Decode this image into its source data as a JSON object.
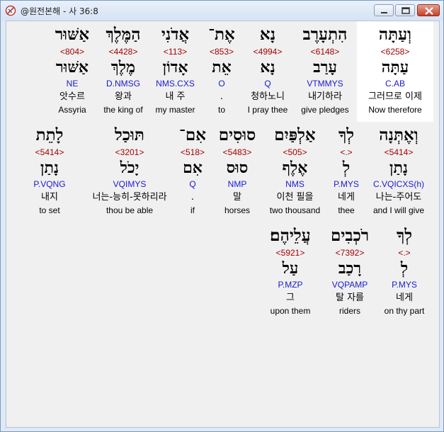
{
  "window": {
    "title": "@원전본해 - 사 36:8"
  },
  "rows": [
    {
      "words": [
        {
          "heb": "וְעַתָּה",
          "strong": "<6258>",
          "lemma": "עַתָּה",
          "parse": "C.AB",
          "korean": "그러므로 이제",
          "english": "Now therefore"
        },
        {
          "heb": "הִתְעָרֶב",
          "strong": "<6148>",
          "lemma": "עָרַב",
          "parse": "VTMMYS",
          "korean": "내기하라",
          "english": "give pledges"
        },
        {
          "heb": "נָא",
          "strong": "<4994>",
          "lemma": "נָא",
          "parse": "Q",
          "korean": "청하노니",
          "english": "I pray thee"
        },
        {
          "heb": "אֶת־",
          "strong": "<853>",
          "lemma": "אֵת",
          "parse": "O",
          "korean": ".",
          "english": "to"
        },
        {
          "heb": "אֲדֹנִי",
          "strong": "<113>",
          "lemma": "אָדוֹן",
          "parse": "NMS.CXS",
          "korean": "내 주",
          "english": "my master"
        },
        {
          "heb": "הַמֶּלֶךְ",
          "strong": "<4428>",
          "lemma": "מֶלֶךְ",
          "parse": "D.NMSG",
          "korean": "왕과",
          "english": "the king of"
        },
        {
          "heb": "אַשּׁוּר",
          "strong": "<804>",
          "lemma": "אַשּׁוּר",
          "parse": "NE",
          "korean": "앗수르",
          "english": "Assyria"
        }
      ]
    },
    {
      "words": [
        {
          "heb": "וְאֶתְּנָה",
          "strong": "<5414>",
          "lemma": "נָתַן",
          "parse": "C.VQICXS(h)",
          "korean": "나는-주어도",
          "english": "and I will give"
        },
        {
          "heb": "לְךָ",
          "strong": "<.>",
          "lemma": "לְ",
          "parse": "P.MYS",
          "korean": "네게",
          "english": "thee"
        },
        {
          "heb": "אַלְפַּיִם",
          "strong": "<505>",
          "lemma": "אֶלֶף",
          "parse": "NMS",
          "korean": "이천 필을",
          "english": "two thousand"
        },
        {
          "heb": "סוּסִים",
          "strong": "<5483>",
          "lemma": "סוּס",
          "parse": "NMP",
          "korean": "말",
          "english": "horses"
        },
        {
          "heb": "אִם־",
          "strong": "<518>",
          "lemma": "אִם",
          "parse": "Q",
          "korean": ".",
          "english": "if"
        },
        {
          "heb": "תּוּכַל",
          "strong": "<3201>",
          "lemma": "יָכֹל",
          "parse": "VQIMYS",
          "korean": "너는-능히-못하리라",
          "english": "thou be able"
        },
        {
          "heb": "לָתֵת",
          "strong": "<5414>",
          "lemma": "נָתַן",
          "parse": "P.VQNG",
          "korean": "내지",
          "english": "to set"
        }
      ]
    },
    {
      "words": [
        {
          "heb": "לְךָ",
          "strong": "<.>",
          "lemma": "לְ",
          "parse": "P.MYS",
          "korean": "네게",
          "english": "on thy part"
        },
        {
          "heb": "רֹכְבִים",
          "strong": "<7392>",
          "lemma": "רָכַב",
          "parse": "VQPAMP",
          "korean": "탈 자를",
          "english": "riders"
        },
        {
          "heb": "עֲלֵיהֶם׃",
          "strong": "<5921>",
          "lemma": "עַל",
          "parse": "P.MZP",
          "korean": "그",
          "english": "upon them"
        }
      ]
    }
  ]
}
